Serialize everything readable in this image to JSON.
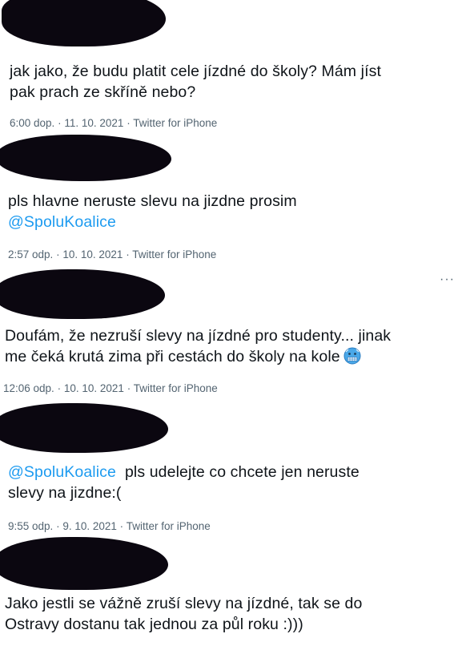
{
  "tweets": [
    {
      "text_lines": [
        "jak jako, že budu platit cele jízdné do školy? Mám jíst",
        "pak prach ze skříně nebo?"
      ],
      "time": "6:00 dop.",
      "date": "11. 10. 2021",
      "source": "Twitter for iPhone"
    },
    {
      "text_lines": [
        "pls hlavne neruste slevu na jizdne prosim"
      ],
      "mention": "@SpoluKoalice",
      "time": "2:57 odp.",
      "date": "10. 10. 2021",
      "source": "Twitter for iPhone"
    },
    {
      "text_lines": [
        "Doufám, že nezruší slevy na jízdné pro studenty... jinak",
        "me čeká krutá zima při cestách do školy na kole"
      ],
      "emoji": "cold-face-emoji",
      "more_icon": "···",
      "time": "12:06 odp.",
      "date": "10. 10. 2021",
      "source": "Twitter for iPhone"
    },
    {
      "mention": "@SpoluKoalice",
      "text_after_mention": "pls udelejte co chcete jen neruste",
      "text_line2": "slevy na jizdne:(",
      "time": "9:55 odp.",
      "date": "9. 10. 2021",
      "source": "Twitter for iPhone"
    },
    {
      "text_lines": [
        "Jako jestli se vážně zruší slevy na jízdné, tak se do",
        "Ostravy dostanu tak jednou za půl roku :)))"
      ]
    }
  ],
  "separator": "·",
  "colors": {
    "text": "#0f1419",
    "meta": "#536471",
    "mention": "#1d9bf0",
    "redaction": "#0b0710"
  }
}
